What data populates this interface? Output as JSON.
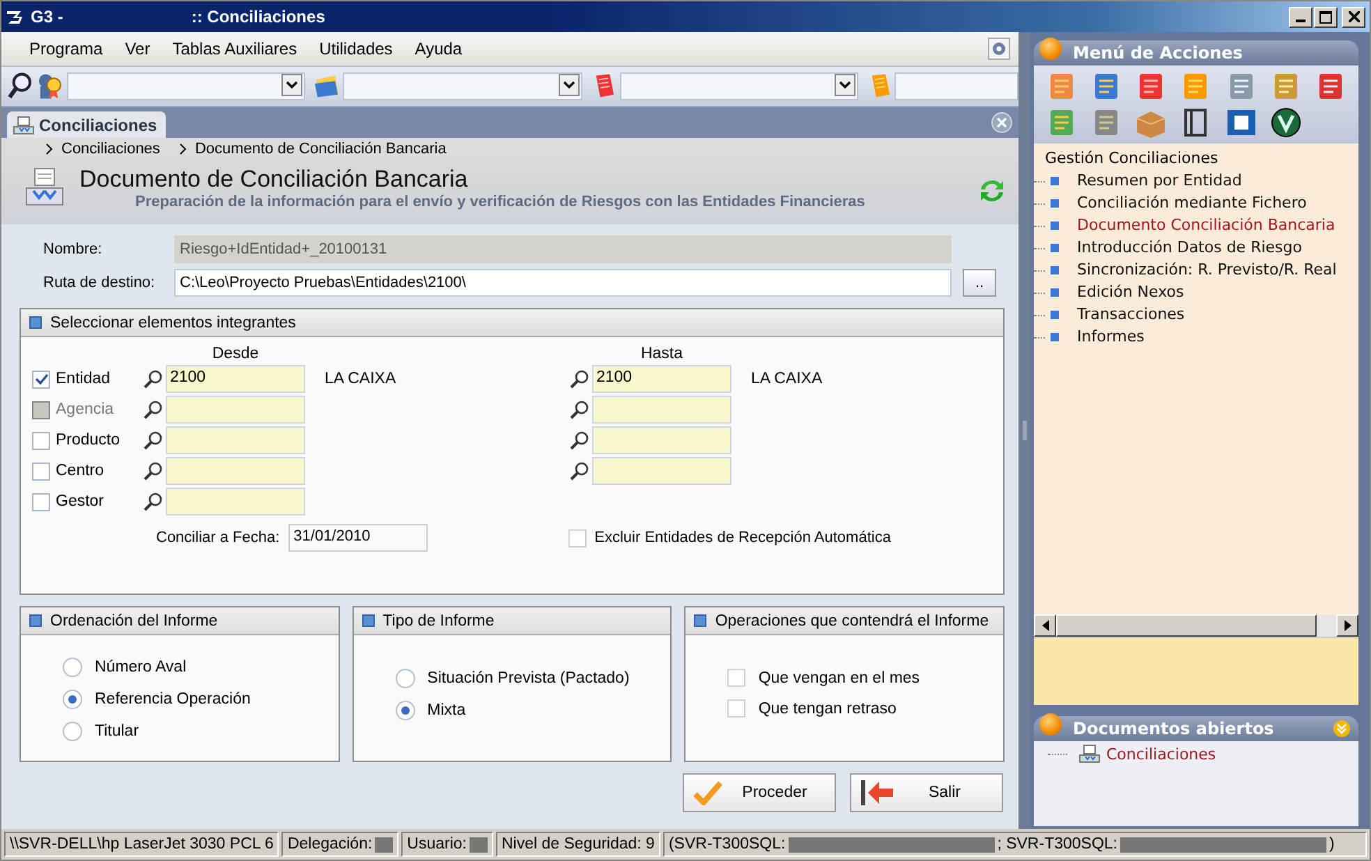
{
  "window": {
    "app": "G3 -",
    "title": ":: Conciliaciones"
  },
  "menu": [
    {
      "label": "Programa"
    },
    {
      "label": "Ver"
    },
    {
      "label": "Tablas Auxiliares"
    },
    {
      "label": "Utilidades"
    },
    {
      "label": "Ayuda"
    }
  ],
  "document_tab": {
    "label": "Conciliaciones",
    "selected": true
  },
  "breadcrumb": [
    "Conciliaciones",
    "Documento de Conciliación Bancaria"
  ],
  "header": {
    "title": "Documento de Conciliación Bancaria",
    "subtitle": "Preparación de la información para el envío y verificación de Riesgos con las Entidades Financieras"
  },
  "fields": [
    {
      "label": "Nombre:",
      "value": "Riesgo+IdEntidad+_20100131",
      "disabled": true
    },
    {
      "label": "Ruta de destino:",
      "value": "C:\\Leo\\Proyecto Pruebas\\Entidades\\2100\\",
      "disabled": false,
      "browse": ".."
    }
  ],
  "selection": {
    "title": "Seleccionar elementos integrantes",
    "from_heading": "Desde",
    "to_heading": "Hasta",
    "rows": [
      {
        "label": "Entidad",
        "checked": true,
        "disabled": false,
        "from": "2100",
        "from_name": "LA CAIXA",
        "has_to": true,
        "to": "2100",
        "to_name": "LA CAIXA"
      },
      {
        "label": "Agencia",
        "checked": false,
        "disabled": true,
        "has_to": true
      },
      {
        "label": "Producto",
        "checked": false,
        "disabled": false,
        "has_to": true
      },
      {
        "label": "Centro",
        "checked": false,
        "disabled": false,
        "has_to": true
      },
      {
        "label": "Gestor",
        "checked": false,
        "disabled": false,
        "has_to": false
      }
    ],
    "date_label": "Conciliar a Fecha:",
    "date_value": "31/01/2010",
    "exclude": {
      "label": "Excluir Entidades de Recepción Automática",
      "checked": false
    }
  },
  "panels": [
    {
      "title": "Ordenación del Informe",
      "kind": "radio",
      "options": [
        {
          "label": "Número Aval",
          "selected": false
        },
        {
          "label": "Referencia Operación",
          "selected": true
        },
        {
          "label": "Titular",
          "selected": false
        }
      ]
    },
    {
      "title": "Tipo de Informe",
      "kind": "radio",
      "options": [
        {
          "label": "Situación Prevista (Pactado)",
          "selected": false
        },
        {
          "label": "Mixta",
          "selected": true
        }
      ]
    },
    {
      "title": "Operaciones que contendrá el Informe",
      "kind": "checkbox",
      "options": [
        {
          "label": "Que vengan en el mes",
          "checked": false
        },
        {
          "label": "Que tengan retraso",
          "checked": false
        }
      ]
    }
  ],
  "buttons": [
    {
      "label": "Proceder",
      "kind": "proceed"
    },
    {
      "label": "Salir",
      "kind": "exit"
    }
  ],
  "actions_menu": {
    "title": "Menú de Acciones",
    "group": "Gestión Conciliaciones",
    "items": [
      {
        "label": "Resumen por Entidad",
        "selected": false
      },
      {
        "label": "Conciliación mediante Fichero",
        "selected": false
      },
      {
        "label": "Documento Conciliación Bancaria",
        "selected": true
      },
      {
        "label": "Introducción Datos de Riesgo",
        "selected": false
      },
      {
        "label": "Sincronización:  R. Previsto/R. Real",
        "selected": false
      },
      {
        "label": "Edición Nexos",
        "selected": false
      },
      {
        "label": "Transacciones",
        "selected": false
      },
      {
        "label": "Informes",
        "selected": false
      }
    ]
  },
  "open_documents": {
    "title": "Documentos abiertos",
    "items": [
      {
        "label": "Conciliaciones"
      }
    ]
  },
  "status_bar": [
    {
      "parts": [
        {
          "kind": "text",
          "text": "\\\\SVR-DELL\\hp LaserJet 3030 PCL 6"
        }
      ]
    },
    {
      "parts": [
        {
          "kind": "text",
          "text": "Delegación:"
        },
        {
          "kind": "redacted"
        }
      ]
    },
    {
      "parts": [
        {
          "kind": "text",
          "text": "Usuario:"
        },
        {
          "kind": "redacted"
        }
      ]
    },
    {
      "parts": [
        {
          "kind": "text",
          "text": "Nivel de Seguridad: 9"
        }
      ]
    },
    {
      "parts": [
        {
          "kind": "text",
          "text": "(SVR-T300SQL:"
        },
        {
          "kind": "redacted",
          "wide": true
        },
        {
          "kind": "text",
          "text": "; SVR-T300SQL:"
        },
        {
          "kind": "redacted",
          "wide": true
        },
        {
          "kind": "text",
          "text": ")"
        }
      ]
    }
  ]
}
